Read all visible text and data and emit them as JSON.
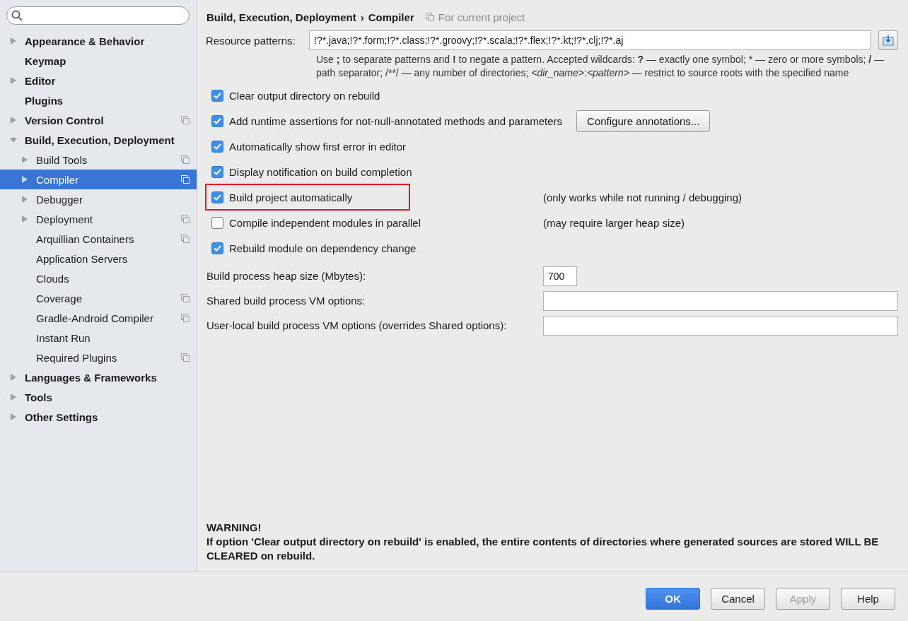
{
  "sidebar": {
    "items": [
      {
        "label": "Appearance & Behavior",
        "expanded": false,
        "selected": false,
        "project_scope": false
      },
      {
        "label": "Keymap",
        "selected": false,
        "project_scope": false
      },
      {
        "label": "Editor",
        "expanded": false,
        "selected": false,
        "project_scope": false
      },
      {
        "label": "Plugins",
        "selected": false,
        "project_scope": false
      },
      {
        "label": "Version Control",
        "expanded": false,
        "selected": false,
        "project_scope": true
      },
      {
        "label": "Build, Execution, Deployment",
        "expanded": true,
        "selected": false,
        "project_scope": false,
        "children": [
          {
            "label": "Build Tools",
            "expanded": false,
            "selected": false,
            "project_scope": true
          },
          {
            "label": "Compiler",
            "expanded": false,
            "selected": true,
            "project_scope": true
          },
          {
            "label": "Debugger",
            "expanded": false,
            "selected": false,
            "project_scope": false
          },
          {
            "label": "Deployment",
            "expanded": false,
            "selected": false,
            "project_scope": true
          },
          {
            "label": "Arquillian Containers",
            "selected": false,
            "project_scope": true
          },
          {
            "label": "Application Servers",
            "selected": false,
            "project_scope": false
          },
          {
            "label": "Clouds",
            "selected": false,
            "project_scope": false
          },
          {
            "label": "Coverage",
            "selected": false,
            "project_scope": true
          },
          {
            "label": "Gradle-Android Compiler",
            "selected": false,
            "project_scope": true
          },
          {
            "label": "Instant Run",
            "selected": false,
            "project_scope": false
          },
          {
            "label": "Required Plugins",
            "selected": false,
            "project_scope": true
          }
        ]
      },
      {
        "label": "Languages & Frameworks",
        "expanded": false,
        "selected": false,
        "project_scope": false
      },
      {
        "label": "Tools",
        "expanded": false,
        "selected": false,
        "project_scope": false
      },
      {
        "label": "Other Settings",
        "expanded": false,
        "selected": false,
        "project_scope": false
      }
    ]
  },
  "breadcrumb": {
    "path": [
      "Build, Execution, Deployment",
      "Compiler"
    ],
    "separator": "›",
    "scope": "For current project"
  },
  "resource_patterns": {
    "label": "Resource patterns:",
    "value": "!?*.java;!?*.form;!?*.class;!?*.groovy;!?*.scala;!?*.flex;!?*.kt;!?*.clj;!?*.aj",
    "hint": "Use **;** to separate patterns and **!** to negate a pattern. Accepted wildcards: **?** — exactly one symbol; * — zero or more symbols; **/** — path separator; /**/ — any number of directories;  *<dir_name>*:*<pattern>* — restrict to source roots with the specified name"
  },
  "options": [
    {
      "label": "Clear output directory on rebuild",
      "checked": true,
      "highlighted": false
    },
    {
      "label": "Add runtime assertions for not-null-annotated methods and parameters",
      "checked": true,
      "highlighted": false,
      "button": "Configure annotations..."
    },
    {
      "label": "Automatically show first error in editor",
      "checked": true,
      "highlighted": false
    },
    {
      "label": "Display notification on build completion",
      "checked": true,
      "highlighted": false
    },
    {
      "label": "Build project automatically",
      "checked": true,
      "highlighted": true,
      "note": "(only works while not running / debugging)"
    },
    {
      "label": "Compile independent modules in parallel",
      "checked": false,
      "highlighted": false,
      "note": "(may require larger heap size)"
    },
    {
      "label": "Rebuild module on dependency change",
      "checked": true,
      "highlighted": false
    }
  ],
  "fields": [
    {
      "label": "Build process heap size (Mbytes):",
      "value": "700",
      "kind": "short"
    },
    {
      "label": "Shared build process VM options:",
      "kind": "wide"
    },
    {
      "label": "User-local build process VM options (overrides Shared options):",
      "kind": "wide"
    }
  ],
  "warning": {
    "title": "WARNING!",
    "text": "If option 'Clear output directory on rebuild' is enabled, the entire contents of directories where generated sources are stored WILL BE CLEARED on rebuild."
  },
  "buttons": [
    {
      "label": "OK",
      "kind": "primary",
      "disabled": false
    },
    {
      "label": "Cancel",
      "kind": "normal",
      "disabled": false
    },
    {
      "label": "Apply",
      "kind": "normal",
      "disabled": true
    },
    {
      "label": "Help",
      "kind": "normal",
      "disabled": false
    }
  ]
}
